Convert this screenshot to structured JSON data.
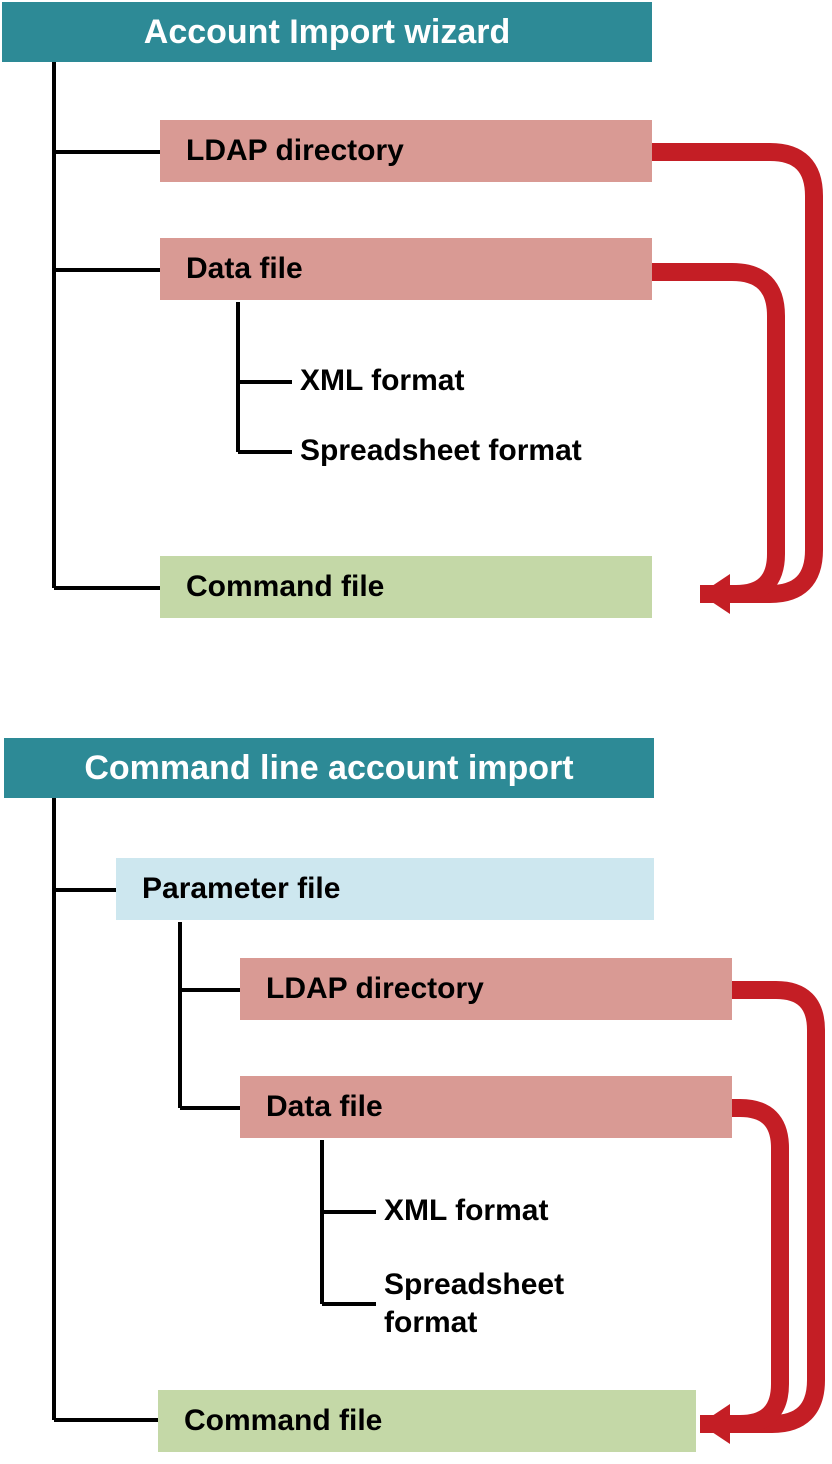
{
  "colors": {
    "teal": "#2d8a96",
    "rose": "#d99a94",
    "green": "#c4d8a7",
    "lightblue": "#cde7ef",
    "arrow": "#c41e25",
    "line": "#000000"
  },
  "section1": {
    "title": "Account Import wizard",
    "ldap": "LDAP directory",
    "datafile": "Data file",
    "xml": "XML format",
    "spreadsheet": "Spreadsheet format",
    "command": "Command file"
  },
  "section2": {
    "title": "Command line account import",
    "paramfile": "Parameter file",
    "ldap": "LDAP directory",
    "datafile": "Data file",
    "xml": "XML format",
    "spreadsheet": "Spreadsheet",
    "format": "format",
    "command": "Command file"
  }
}
